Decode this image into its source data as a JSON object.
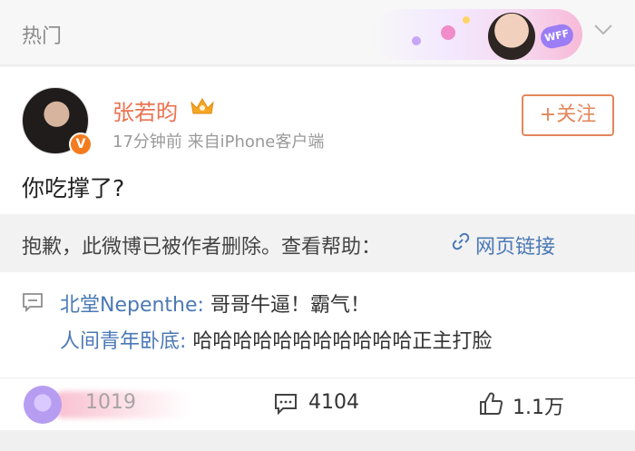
{
  "section": {
    "title": "热门",
    "banner_tag": "WFF"
  },
  "post": {
    "username": "张若昀",
    "verified_badge": "V",
    "meta": "17分钟前  来自iPhone客户端",
    "follow_label": "+关注",
    "text": "你吃撑了?"
  },
  "repost": {
    "deleted_text": "抱歉，此微博已被作者删除。查看帮助：",
    "link_text": "网页链接"
  },
  "comments": [
    {
      "author": "北堂Nepenthe:",
      "text": " 哥哥牛逼！霸气！"
    },
    {
      "author": "人间青年卧底:",
      "text": " 哈哈哈哈哈哈哈哈哈哈哈正主打脸"
    }
  ],
  "actions": {
    "forward_count": "1019",
    "comment_count": "4104",
    "like_count": "1.1万"
  },
  "icons": {
    "crown": "crown-icon",
    "link": "link-icon",
    "comment": "comment-icon",
    "like": "thumbs-up-icon",
    "chevron": "chevron-down-icon"
  },
  "colors": {
    "username": "#eb7350",
    "link": "#4b79b5",
    "follow": "#e3865a",
    "verified": "#f47c1f"
  }
}
